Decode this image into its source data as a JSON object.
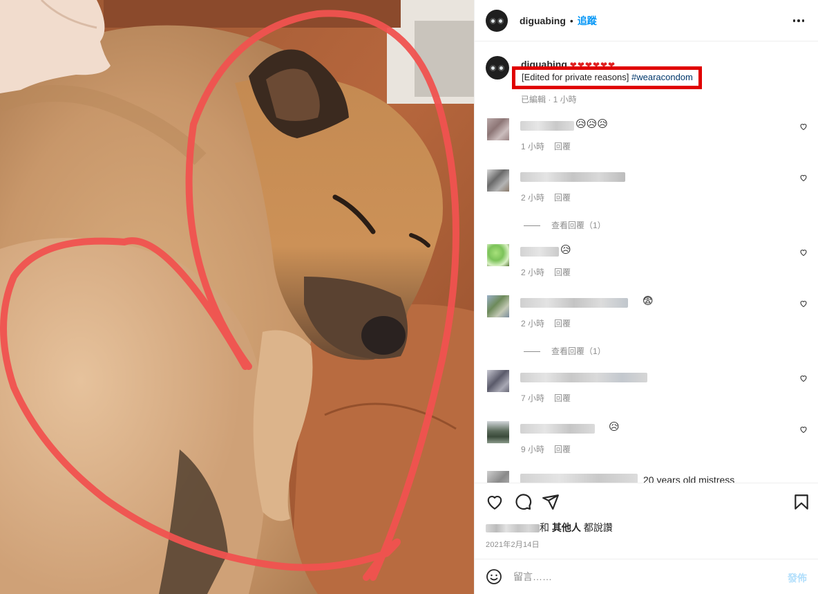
{
  "post": {
    "username": "diguabing",
    "separator": "•",
    "follow_label": "追蹤",
    "more_icon": "more-horizontal-icon"
  },
  "caption": {
    "username": "diguabing",
    "hearts": "❤❤❤❤❤❤",
    "text": "[Edited for private reasons]",
    "hashtag": "#wearacondom",
    "meta": "已編輯 · 1 小時",
    "highlight_color": "#e00000"
  },
  "comments": [
    {
      "emoji": "😥😥😥",
      "time": "1 小時",
      "reply": "回覆"
    },
    {
      "emoji": "",
      "time": "2 小時",
      "reply": "回覆",
      "view_replies": "查看回覆（1）"
    },
    {
      "emoji": "😥",
      "time": "2 小時",
      "reply": "回覆"
    },
    {
      "emoji": "😨",
      "time": "2 小時",
      "reply": "回覆",
      "view_replies": "查看回覆（1）"
    },
    {
      "emoji": "",
      "time": "7 小時",
      "reply": "回覆"
    },
    {
      "emoji": "😥",
      "time": "9 小時",
      "reply": "回覆"
    }
  ],
  "partial_comment": "20 years old mistress",
  "actions": {
    "like_icon": "heart-icon",
    "comment_icon": "comment-icon",
    "share_icon": "paper-plane-icon",
    "save_icon": "bookmark-icon"
  },
  "likes": {
    "joiner": "和",
    "others": "其他人",
    "suffix": "都說讚"
  },
  "date": "2021年2月14日",
  "add_comment": {
    "placeholder": "留言……",
    "post_label": "發佈",
    "emoji_icon": "smiley-icon"
  },
  "colors": {
    "accent": "#0095f6",
    "secondary_text": "#8e8e8e",
    "heart_drawing": "#f0524f"
  }
}
